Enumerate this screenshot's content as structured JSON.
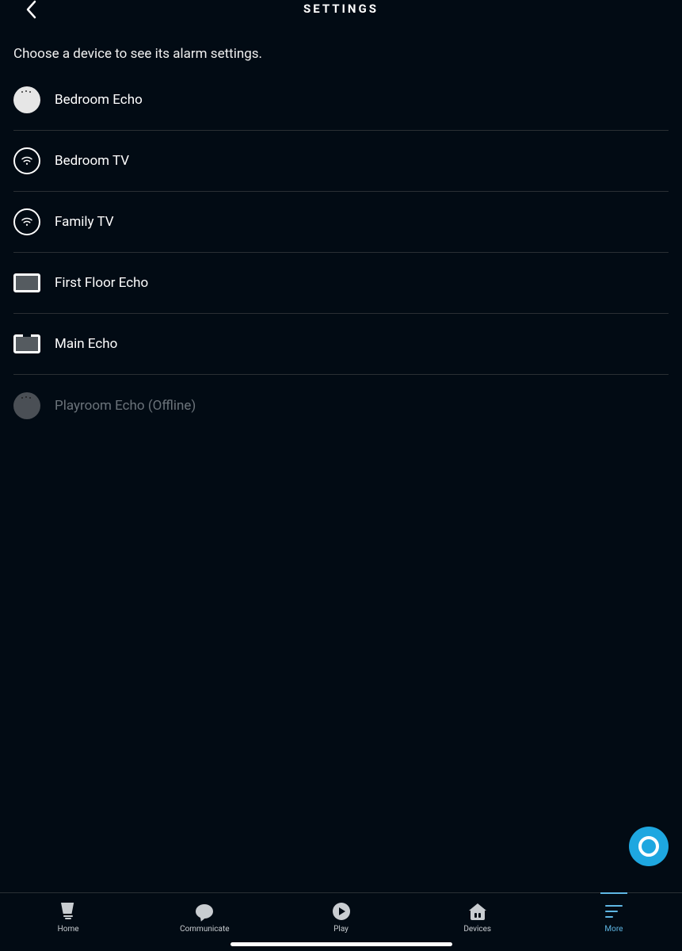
{
  "header": {
    "title": "SETTINGS"
  },
  "subtitle": "Choose a device to see its alarm settings.",
  "devices": [
    {
      "name": "Bedroom Echo",
      "icon": "dot",
      "offline": false
    },
    {
      "name": "Bedroom TV",
      "icon": "ring",
      "offline": false
    },
    {
      "name": "Family TV",
      "icon": "ring",
      "offline": false
    },
    {
      "name": "First Floor Echo",
      "icon": "screen",
      "offline": false
    },
    {
      "name": "Main Echo",
      "icon": "screen-notch",
      "offline": false
    },
    {
      "name": "Playroom Echo (Offline)",
      "icon": "dot",
      "offline": true
    }
  ],
  "tabs": [
    {
      "label": "Home",
      "name": "home",
      "active": false
    },
    {
      "label": "Communicate",
      "name": "communicate",
      "active": false
    },
    {
      "label": "Play",
      "name": "play",
      "active": false
    },
    {
      "label": "Devices",
      "name": "devices",
      "active": false
    },
    {
      "label": "More",
      "name": "more",
      "active": true
    }
  ]
}
